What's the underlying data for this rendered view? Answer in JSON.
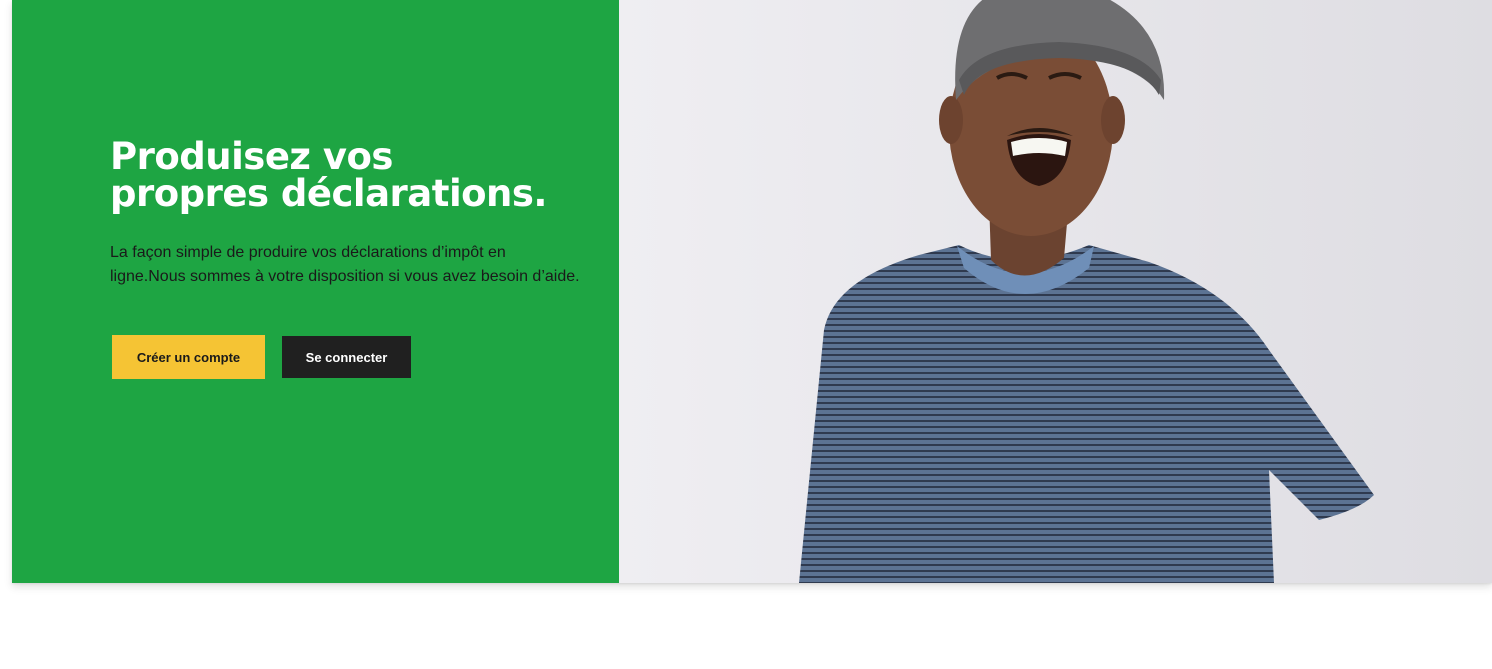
{
  "hero": {
    "headline_line1": "Produisez vos",
    "headline_line2": "propres déclarations.",
    "description": "La façon simple de produire vos déclarations d’impôt en ligne.Nous sommes à votre disposition si vous avez besoin d’aide.",
    "create_account_label": "Créer un compte",
    "login_label": "Se connecter"
  },
  "colors": {
    "panel_green": "#1ea543",
    "create_button_yellow": "#f5c434",
    "login_button_dark": "#202020"
  }
}
